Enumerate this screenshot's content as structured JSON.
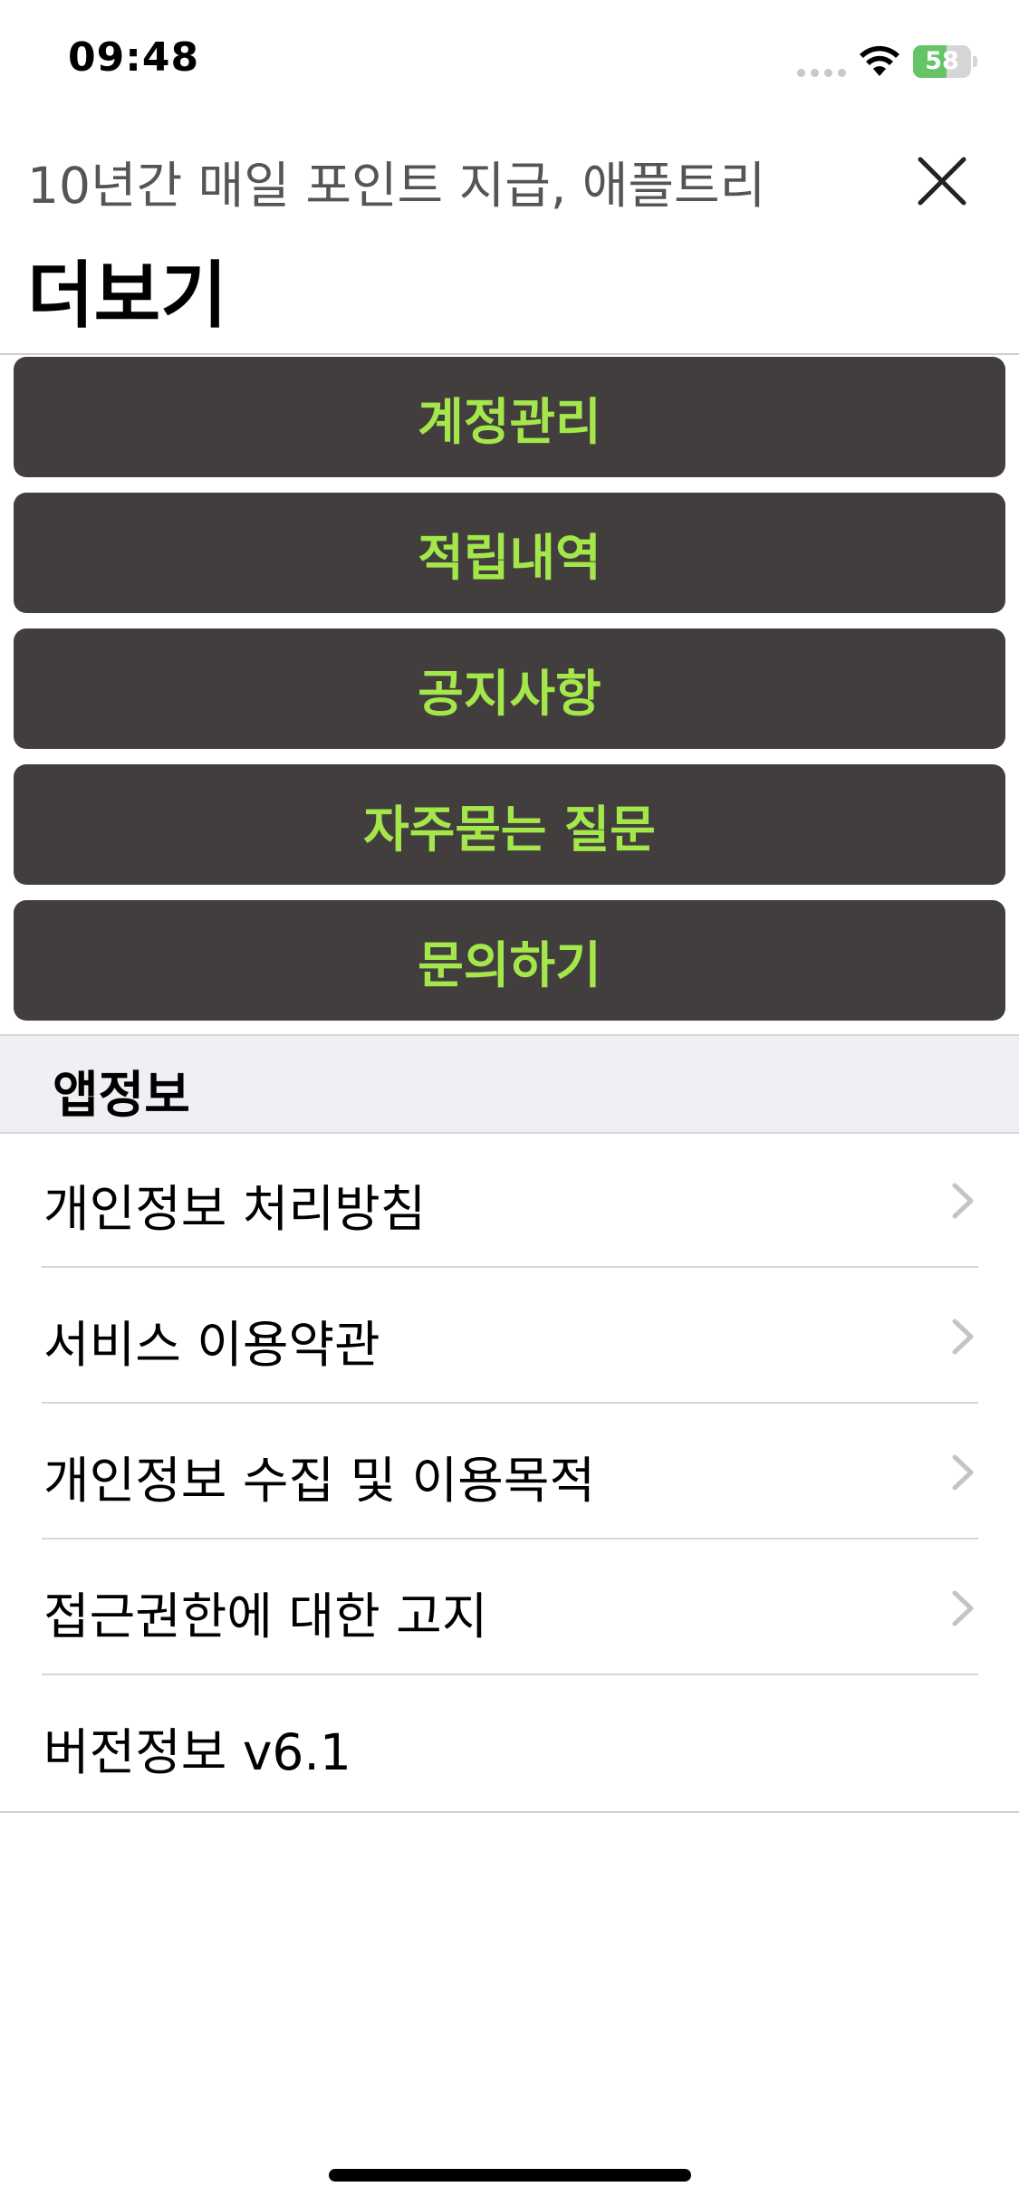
{
  "status_bar": {
    "time": "09:48",
    "battery": "58",
    "battery_level": 0.58,
    "icons": [
      "signal-dots-icon",
      "wifi-icon",
      "battery-charging-icon"
    ]
  },
  "header": {
    "subtitle": "10년간 매일 포인트 지급, 애플트리",
    "title": "더보기",
    "close_icon": "close-icon"
  },
  "menu_buttons": [
    {
      "label": "계정관리"
    },
    {
      "label": "적립내역"
    },
    {
      "label": "공지사항"
    },
    {
      "label": "자주묻는 질문"
    },
    {
      "label": "문의하기"
    }
  ],
  "app_info": {
    "section_label": "앱정보",
    "rows": [
      {
        "label": "개인정보 처리방침",
        "chevron": true
      },
      {
        "label": "서비스 이용약관",
        "chevron": true
      },
      {
        "label": "개인정보 수집 및 이용목적",
        "chevron": true
      },
      {
        "label": "접근권한에 대한 고지",
        "chevron": true
      },
      {
        "label": "버전정보 v6.1",
        "chevron": false
      }
    ]
  },
  "colors": {
    "button_bg": "#433e3e",
    "button_text": "#a4e74a",
    "section_bg": "#f0f0f4",
    "battery_green": "#65c466"
  }
}
